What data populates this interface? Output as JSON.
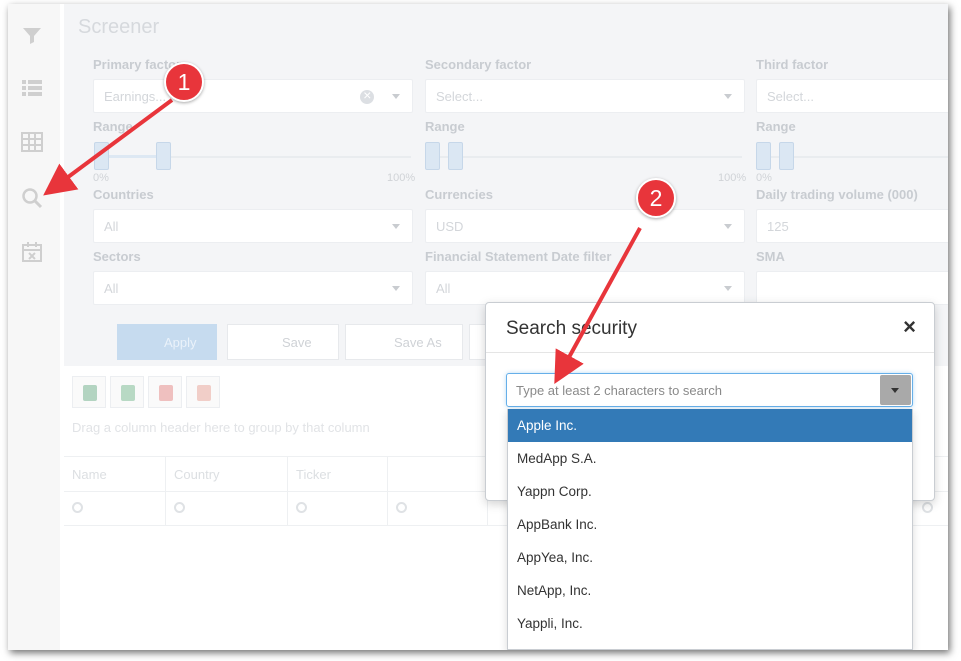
{
  "page": {
    "title": "Screener"
  },
  "rail": {
    "icons": [
      "filter-icon",
      "list-icon",
      "table-icon",
      "search-icon",
      "calendar-icon"
    ]
  },
  "filters": {
    "primary": {
      "label": "Primary factor",
      "value": "Earnings..."
    },
    "secondary": {
      "label": "Secondary factor",
      "placeholder": "Select..."
    },
    "third": {
      "label": "Third factor",
      "placeholder": "Select..."
    },
    "range_label": "Range",
    "range_min": "0%",
    "range_max": "100%",
    "countries": {
      "label": "Countries",
      "value": "All"
    },
    "currencies": {
      "label": "Currencies",
      "value": "USD"
    },
    "daily_volume": {
      "label": "Daily trading volume (000)",
      "value": "125"
    },
    "sectors": {
      "label": "Sectors",
      "value": "All"
    },
    "fs_date": {
      "label": "Financial Statement Date filter",
      "value": "All"
    },
    "sma": {
      "label": "SMA",
      "value": ""
    }
  },
  "actions": {
    "apply": "Apply",
    "save": "Save",
    "save_as": "Save As"
  },
  "grid": {
    "group_hint": "Drag a column header here to group by that column",
    "columns": [
      "Name",
      "Country",
      "Ticker"
    ]
  },
  "modal": {
    "title": "Search security",
    "close": "×",
    "placeholder": "Type at least 2 characters to search",
    "results": [
      "Apple Inc.",
      "MedApp S.A.",
      "Yappn Corp.",
      "AppBank Inc.",
      "AppYea, Inc.",
      "NetApp, Inc.",
      "Yappli, Inc."
    ],
    "selected_index": 0
  },
  "annotations": {
    "step1": "1",
    "step2": "2"
  },
  "colors": {
    "accent": "#337ab7",
    "callout": "#e8353b",
    "arrow": "#e8353b"
  }
}
